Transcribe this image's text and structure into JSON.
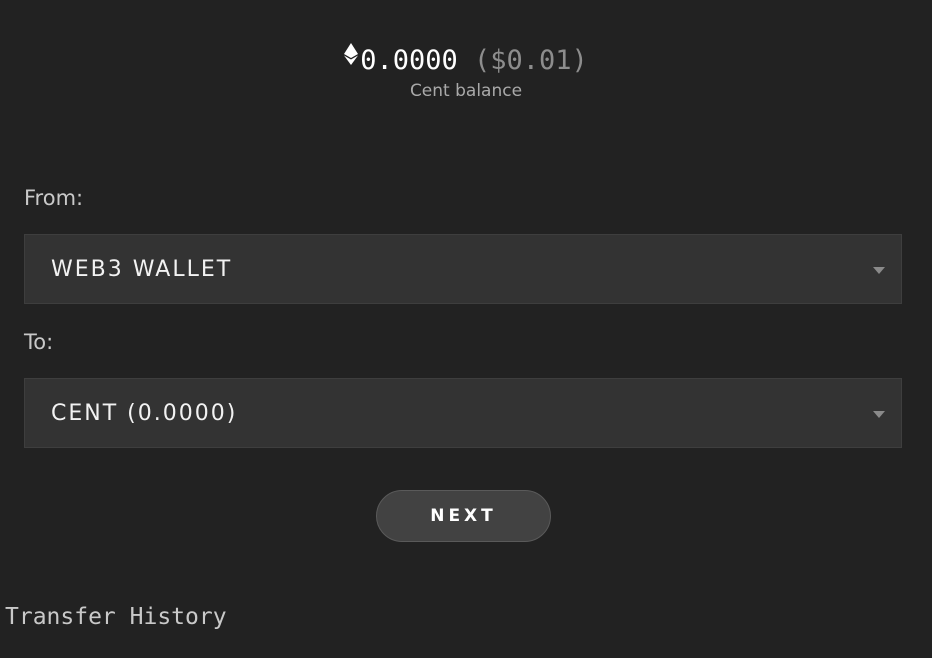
{
  "balance": {
    "amount": "0.0000",
    "usd": "($0.01)",
    "label": "Cent balance",
    "icon": "ethereum-icon"
  },
  "from": {
    "label": "From:",
    "selected": "WEB3 WALLET"
  },
  "to": {
    "label": "To:",
    "selected": "CENT (0.0000)"
  },
  "next_button": {
    "label": "NEXT"
  },
  "history": {
    "title": "Transfer History"
  }
}
